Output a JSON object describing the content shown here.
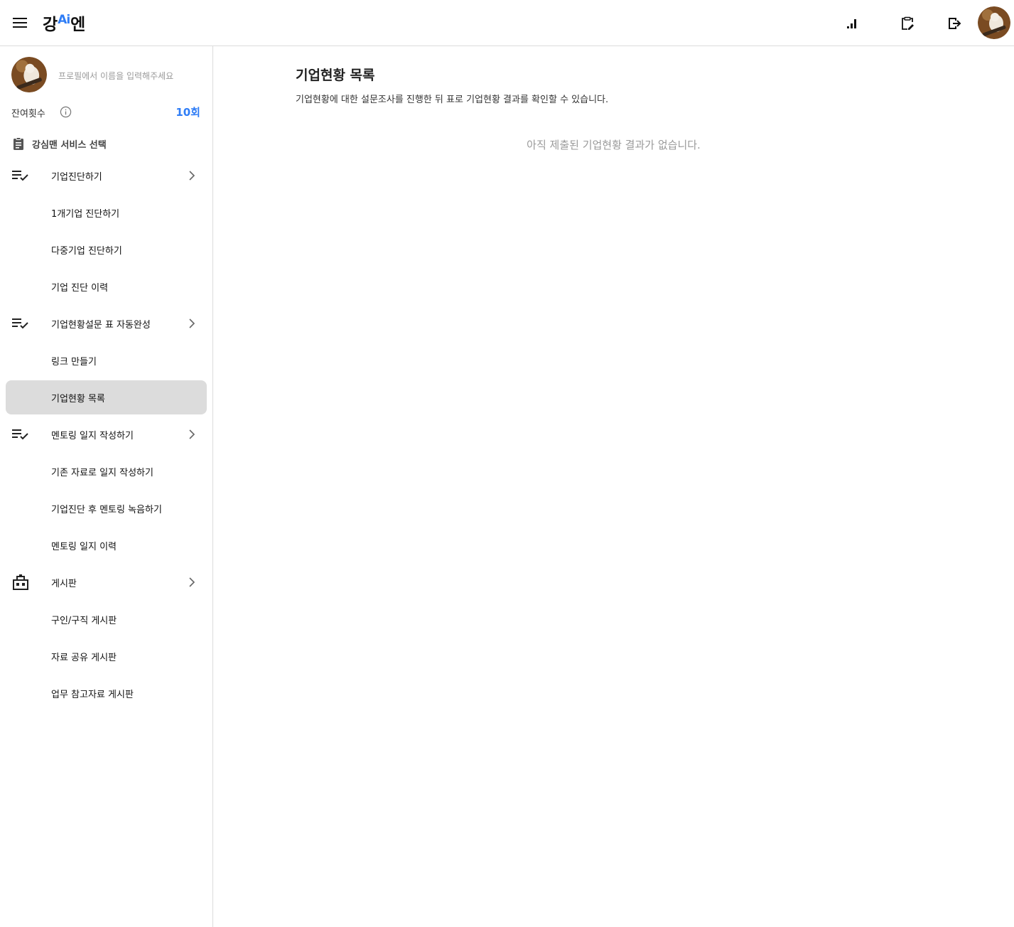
{
  "header": {
    "logo_left": "강",
    "logo_ai": "Ai",
    "logo_right": "엔",
    "icons": [
      "menu-icon",
      "bar-chart-icon",
      "clipboard-edit-icon",
      "logout-icon",
      "avatar"
    ]
  },
  "sidebar": {
    "profile_placeholder": "프로필에서 이름을 입력해주세요",
    "remain_label": "잔여횟수",
    "remain_count": "10회",
    "section_title": "강심맨 서비스 선택",
    "items": [
      {
        "label": "기업진단하기",
        "type": "group",
        "icon": "checklist-icon"
      },
      {
        "label": "1개기업 진단하기",
        "type": "sub"
      },
      {
        "label": "다중기업 진단하기",
        "type": "sub"
      },
      {
        "label": "기업 진단 이력",
        "type": "sub"
      },
      {
        "label": "기업현황설문 표 자동완성",
        "type": "group",
        "icon": "checklist-icon"
      },
      {
        "label": "링크 만들기",
        "type": "sub"
      },
      {
        "label": "기업현황 목록",
        "type": "sub",
        "active": true
      },
      {
        "label": "멘토링 일지 작성하기",
        "type": "group",
        "icon": "checklist-icon"
      },
      {
        "label": "기존 자료로 일지 작성하기",
        "type": "sub"
      },
      {
        "label": "기업진단 후 멘토링 녹음하기",
        "type": "sub"
      },
      {
        "label": "멘토링 일지 이력",
        "type": "sub"
      },
      {
        "label": "게시판",
        "type": "group",
        "icon": "building-icon"
      },
      {
        "label": "구인/구직 게시판",
        "type": "sub"
      },
      {
        "label": "자료 공유 게시판",
        "type": "sub"
      },
      {
        "label": "업무 참고자료 게시판",
        "type": "sub"
      }
    ]
  },
  "main": {
    "title": "기업현황 목록",
    "description": "기업현황에 대한 설문조사를 진행한 뒤 표로 기업현황 결과를 확인할 수 있습니다.",
    "empty_message": "아직 제출된 기업현황 결과가 없습니다."
  },
  "colors": {
    "accent": "#2f7df6",
    "active_bg": "#dcdcdc",
    "muted_text": "#9a9a9a",
    "border": "#dcdcdc"
  }
}
